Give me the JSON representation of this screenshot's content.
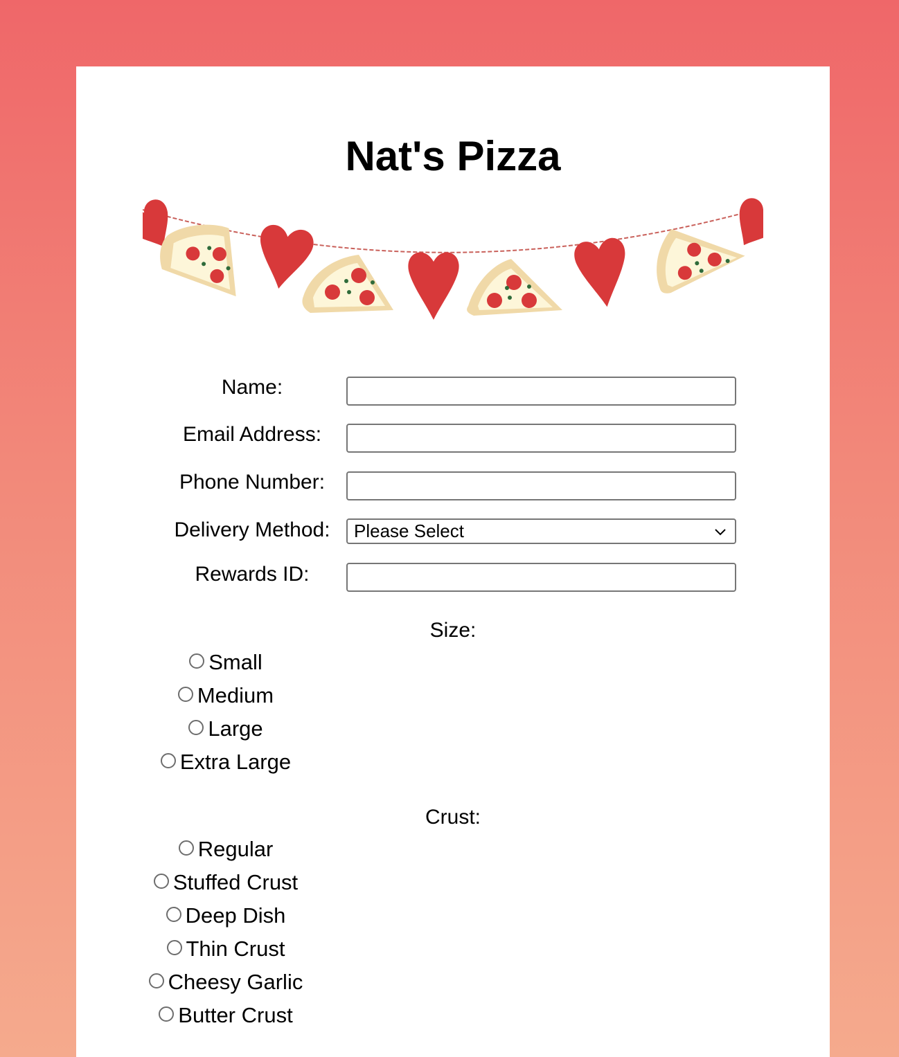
{
  "page": {
    "title": "Nat's Pizza"
  },
  "colors": {
    "background_top": "#ef6769",
    "background_bottom": "#f5aa8d",
    "heart": "#d8393a",
    "pepperoni": "#d8393a",
    "crust": "#f0d9a8",
    "cheese": "#fdf6d9"
  },
  "banner": {
    "icon": "pizza-and-hearts-garland"
  },
  "form": {
    "name_label": "Name:",
    "name_value": "",
    "email_label": "Email Address:",
    "email_value": "",
    "phone_label": "Phone Number:",
    "phone_value": "",
    "delivery_label": "Delivery Method:",
    "delivery_selected": "Please Select",
    "rewards_label": "Rewards ID:",
    "rewards_value": ""
  },
  "size": {
    "label": "Size:",
    "options": [
      "Small",
      "Medium",
      "Large",
      "Extra Large"
    ]
  },
  "crust": {
    "label": "Crust:",
    "options": [
      "Regular",
      "Stuffed Crust",
      "Deep Dish",
      "Thin Crust",
      "Cheesy Garlic",
      "Butter Crust"
    ]
  }
}
